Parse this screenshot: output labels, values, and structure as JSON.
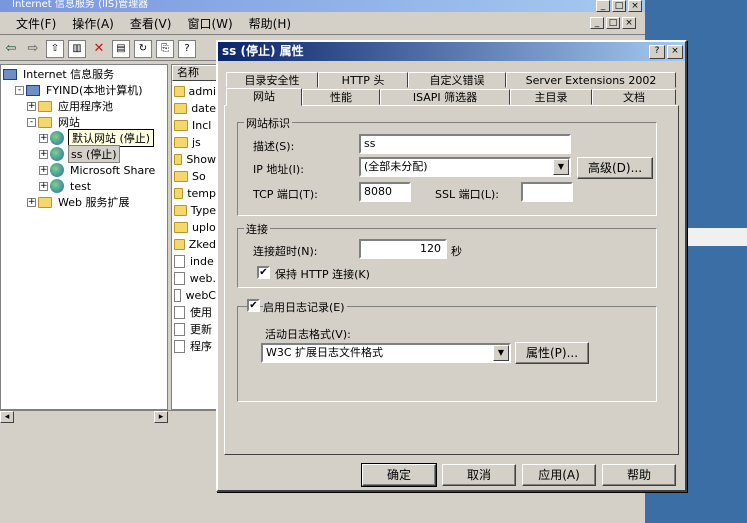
{
  "iis": {
    "title": "Internet 信息服务 (IIS)管理器",
    "menu": [
      "文件(F)",
      "操作(A)",
      "查看(V)",
      "窗口(W)",
      "帮助(H)"
    ],
    "caption_buttons": [
      "_",
      "□",
      "×"
    ],
    "tree": [
      {
        "label": "Internet 信息服务",
        "indent": 0,
        "icon": "computer-icon",
        "expander": ""
      },
      {
        "label": "FYIND(本地计算机)",
        "indent": 1,
        "icon": "computer-icon",
        "expander": "-"
      },
      {
        "label": "应用程序池",
        "indent": 2,
        "icon": "folder-icon",
        "expander": "+"
      },
      {
        "label": "网站",
        "indent": 2,
        "icon": "folder-icon",
        "expander": "-"
      },
      {
        "label": "默认网站 (停止)",
        "indent": 3,
        "icon": "globe-icon",
        "expander": "+",
        "tooltip": true
      },
      {
        "label": "ss (停止)",
        "indent": 3,
        "icon": "globe-icon",
        "expander": "+",
        "selected": true
      },
      {
        "label": "Microsoft Share",
        "indent": 3,
        "icon": "globe-icon",
        "expander": "+"
      },
      {
        "label": "test",
        "indent": 3,
        "icon": "globe-icon",
        "expander": "+"
      },
      {
        "label": "Web 服务扩展",
        "indent": 2,
        "icon": "folder-icon",
        "expander": "+"
      }
    ],
    "list_header": "名称",
    "list_items": [
      {
        "label": "admi",
        "icon": "folder-icon"
      },
      {
        "label": "date",
        "icon": "folder-icon"
      },
      {
        "label": "Incl",
        "icon": "folder-icon"
      },
      {
        "label": "js",
        "icon": "folder-icon"
      },
      {
        "label": "Show",
        "icon": "folder-icon"
      },
      {
        "label": "So",
        "icon": "folder-icon"
      },
      {
        "label": "temp",
        "icon": "folder-icon"
      },
      {
        "label": "Type",
        "icon": "folder-icon"
      },
      {
        "label": "uplo",
        "icon": "folder-icon"
      },
      {
        "label": "Zked",
        "icon": "folder-icon"
      },
      {
        "label": "inde",
        "icon": "file-icon"
      },
      {
        "label": "web.",
        "icon": "file-icon"
      },
      {
        "label": "webC",
        "icon": "file-icon"
      },
      {
        "label": "使用",
        "icon": "file-icon"
      },
      {
        "label": "更新",
        "icon": "file-icon"
      },
      {
        "label": "程序",
        "icon": "file-icon"
      }
    ]
  },
  "dialog": {
    "title": "ss (停止) 属性",
    "help_button": "?",
    "close_button": "×",
    "tabs_back": [
      "目录安全性",
      "HTTP 头",
      "自定义错误",
      "Server Extensions 2002"
    ],
    "tabs_front": [
      "网站",
      "性能",
      "ISAPI 筛选器",
      "主目录",
      "文档"
    ],
    "active_tab": "网站",
    "site_id_group": "网站标识",
    "description_label": "描述(S):",
    "description_value": "ss",
    "ip_label": "IP 地址(I):",
    "ip_value": "(全部未分配)",
    "advanced_button": "高级(D)...",
    "tcp_label": "TCP 端口(T):",
    "tcp_value": "8080",
    "ssl_label": "SSL 端口(L):",
    "ssl_value": "",
    "connection_group": "连接",
    "timeout_label": "连接超时(N):",
    "timeout_value": "120",
    "timeout_unit": "秒",
    "keepalive_label": "保持 HTTP 连接(K)",
    "keepalive_checked": true,
    "logging_label": "启用日志记录(E)",
    "logging_checked": true,
    "log_format_label": "活动日志格式(V):",
    "log_format_value": "W3C 扩展日志文件格式",
    "log_properties_button": "属性(P)...",
    "ok_button": "确定",
    "cancel_button": "取消",
    "apply_button": "应用(A)",
    "help_footer_button": "帮助"
  }
}
